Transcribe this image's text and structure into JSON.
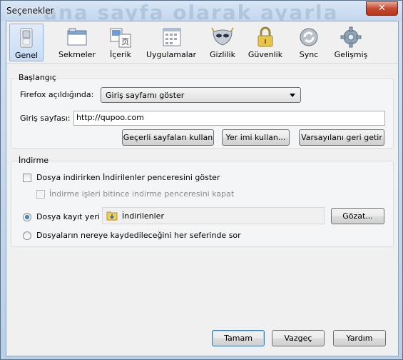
{
  "window": {
    "title": "Seçenekler",
    "background_text": "ana sayfa olarak ayarla",
    "close_symbol": "✕"
  },
  "toolbar": {
    "panes": [
      {
        "label": "Genel",
        "icon": "general-switch-icon",
        "selected": true
      },
      {
        "label": "Sekmeler",
        "icon": "tabs-window-icon",
        "selected": false
      },
      {
        "label": "İçerik",
        "icon": "content-icon",
        "selected": false
      },
      {
        "label": "Uygulamalar",
        "icon": "applications-icon",
        "selected": false
      },
      {
        "label": "Gizlilik",
        "icon": "privacy-mask-icon",
        "selected": false
      },
      {
        "label": "Güvenlik",
        "icon": "security-lock-icon",
        "selected": false
      },
      {
        "label": "Sync",
        "icon": "sync-icon",
        "selected": false
      },
      {
        "label": "Gelişmiş",
        "icon": "advanced-gear-icon",
        "selected": false
      }
    ]
  },
  "startup": {
    "group_title": "Başlangıç",
    "when_starts_label": "Firefox açıldığında:",
    "when_starts_value": "Giriş sayfamı göster",
    "homepage_label": "Giriş sayfası:",
    "homepage_value": "http://qupoo.com",
    "use_current_button": "Geçerli sayfaları kullan",
    "use_bookmark_button": "Yer imi kullan...",
    "restore_default_button": "Varsayılanı geri getir"
  },
  "downloads": {
    "group_title": "İndirme",
    "show_window_label": "Dosya indirirken İndirilenler penceresini göster",
    "close_when_done_label": "İndirme işleri bitince indirme penceresini kapat",
    "save_to_label": "Dosya kayıt yeri",
    "save_folder": "İndirilenler",
    "browse_button": "Gözat...",
    "always_ask_label": "Dosyaların nereye kaydedileceğini her seferinde sor"
  },
  "footer": {
    "ok_button": "Tamam",
    "cancel_button": "Vazgeç",
    "help_button": "Yardım"
  }
}
